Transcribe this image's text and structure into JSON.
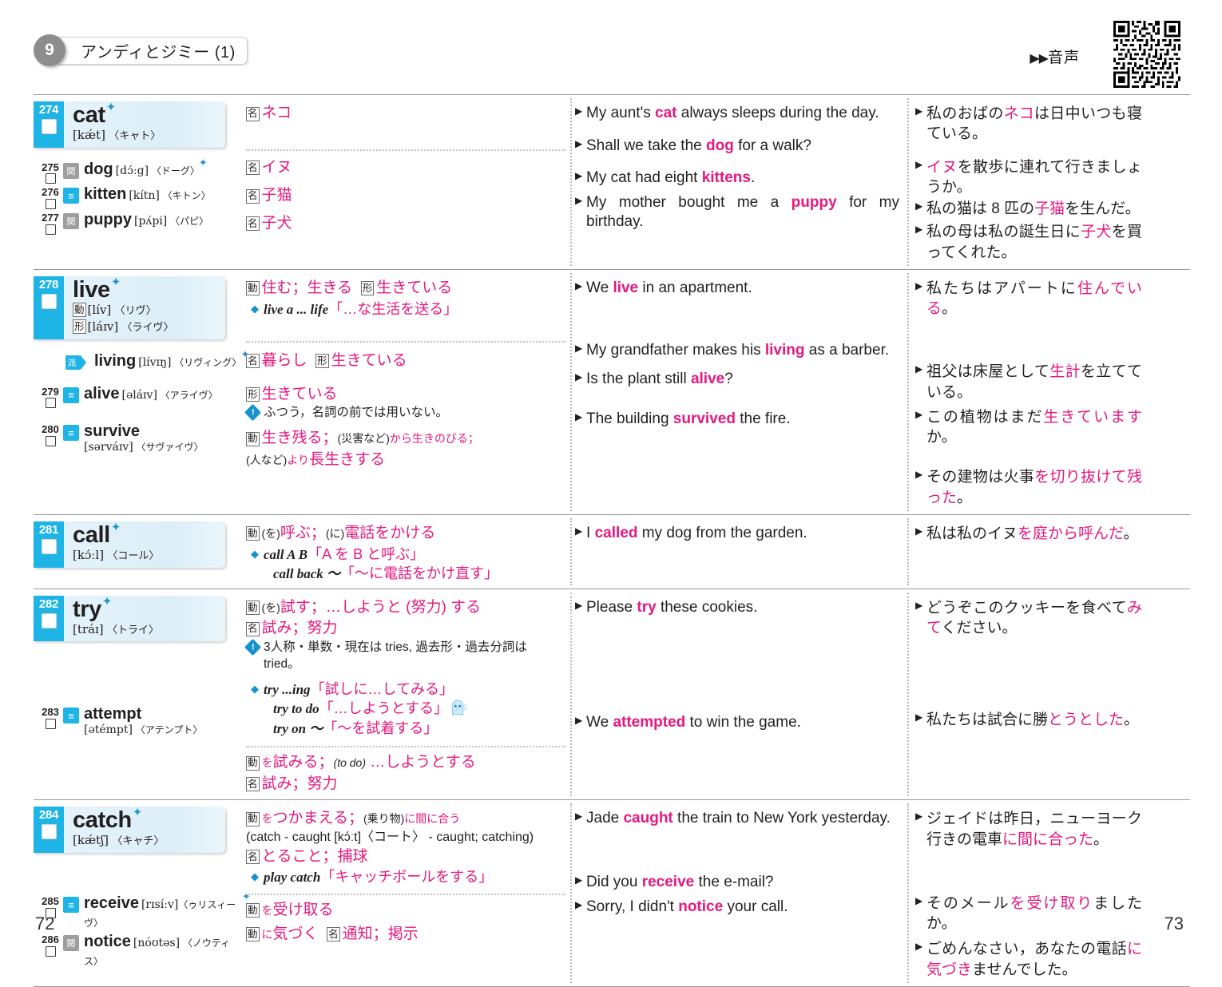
{
  "header": {
    "lesson_number": "9",
    "lesson_title": "アンディとジミー (1)",
    "audio_label": "音声",
    "audio_triangles": "▶▶",
    "qr_alt": "qr-code"
  },
  "footer": {
    "page_left": "72",
    "page_right": "73"
  },
  "blocks": [
    {
      "id": "cat",
      "headword": {
        "num": "274",
        "word": "cat",
        "star": "✦",
        "phonetic": "[kǽt]",
        "kana": "〈キャト〉"
      },
      "subs": [
        {
          "num": "275",
          "badge": "関",
          "badge_type": "kan",
          "word": "dog",
          "star": "✦",
          "phonetic": "[dɔ́ːg]",
          "kana": "〈ドーグ〉"
        },
        {
          "num": "276",
          "badge": "≡",
          "badge_type": "syn",
          "word": "kitten",
          "star": "",
          "phonetic": "[kítn]",
          "kana": "〈キトン〉"
        },
        {
          "num": "277",
          "badge": "関",
          "badge_type": "kan",
          "word": "puppy",
          "star": "",
          "phonetic": "[pʌ́pi]",
          "kana": "〈パピ〉"
        }
      ],
      "meanings": [
        {
          "pos": "名",
          "text": "ネコ"
        },
        {
          "sep": true
        },
        {
          "pos": "名",
          "text": "イヌ"
        },
        {
          "pos": "名",
          "text": "子猫"
        },
        {
          "pos": "名",
          "text": "子犬"
        }
      ],
      "examples": [
        {
          "en": "My aunt's |cat| always sleeps during the day.",
          "jp": "私のおばの|ネコ|は日中いつも寝ている。"
        },
        {
          "en": "Shall we take the |dog| for a walk?",
          "jp": "|イヌ|を散歩に連れて行きましょうか。"
        },
        {
          "en": "My cat had eight |kittens|.",
          "jp": "私の猫は 8 匹の|子猫|を生んだ。"
        },
        {
          "en": "My mother bought me a |puppy| for my birthday.",
          "jp": "私の母は私の誕生日に|子犬|を買ってくれた。"
        }
      ]
    },
    {
      "id": "live",
      "headword": {
        "num": "278",
        "word": "live",
        "star": "✦",
        "phonetic": "[lív]",
        "kana": "〈リヴ〉",
        "pos1": "動",
        "phonetic2": "[láɪv]",
        "kana2": "〈ライヴ〉",
        "pos2": "形"
      },
      "subs": [
        {
          "num": "",
          "badge": "派",
          "badge_type": "der",
          "word": "living",
          "star": "✦",
          "phonetic": "[lívɪŋ]",
          "kana": "〈リヴィング〉"
        },
        {
          "num": "279",
          "badge": "≡",
          "badge_type": "syn",
          "word": "alive",
          "star": "",
          "phonetic": "[əláɪv]",
          "kana": "〈アライヴ〉"
        },
        {
          "num": "280",
          "badge": "≡",
          "badge_type": "syn",
          "word": "survive",
          "star": "",
          "phonetic": "[sərváɪv]",
          "kana": "〈サヴァイヴ〉",
          "stacked": true
        }
      ],
      "meanings_text": {
        "live_verb": "住む；生きる",
        "live_adj": "生きている",
        "live_phrase_en": "live a ... life",
        "live_phrase_jp": "「…な生活を送る」",
        "living_noun": "暮らし",
        "living_adj": "生きている",
        "alive_adj": "生きている",
        "alive_note": "ふつう，名詞の前では用いない。",
        "survive_1": "生き残る；",
        "survive_2": "(災害など)",
        "survive_3": "から生きのびる；",
        "survive_4": "(人など)",
        "survive_5": "より",
        "survive_6": "長生きする"
      },
      "examples": [
        {
          "en": "We |live| in an apartment.",
          "jp": "私たちはアパートに|住んでいる|。"
        },
        {
          "en": "My grandfather makes his |living| as a barber.",
          "jp": "祖父は床屋として|生計|を立てている。"
        },
        {
          "en": "Is the plant still |alive|?",
          "jp": "この植物はまだ|生きています|か。"
        },
        {
          "en": "The building |survived| the fire.",
          "jp": "その建物は火事|を切り抜けて残った|。"
        }
      ]
    },
    {
      "id": "call",
      "headword": {
        "num": "281",
        "word": "call",
        "star": "✦",
        "phonetic": "[kɔ́ːl]",
        "kana": "〈コール〉"
      },
      "meanings_text": {
        "pos": "動",
        "m1a": "(を)",
        "m1b": "呼ぶ；",
        "m1c": "(に)",
        "m1d": "電話をかける",
        "p1_en": "call A B",
        "p1_jp": "「A を B と呼ぶ」",
        "p2_en": "call back ～",
        "p2_jp": "「～に電話をかけ直す」"
      },
      "examples": [
        {
          "en": "I |called| my dog from the garden.",
          "jp": "私は私のイヌ|を庭から呼んだ|。"
        }
      ]
    },
    {
      "id": "try",
      "headword": {
        "num": "282",
        "word": "try",
        "star": "✦",
        "phonetic": "[tráɪ]",
        "kana": "〈トライ〉"
      },
      "subs": [
        {
          "num": "283",
          "badge": "≡",
          "badge_type": "syn",
          "word": "attempt",
          "star": "",
          "phonetic": "[ətémpt]",
          "kana": "〈アテンプト〉",
          "stacked": true
        }
      ],
      "meanings_text": {
        "m1a": "(を)",
        "m1b": "試す；…しようと (努力) する",
        "m2": "試み；努力",
        "note": "3人称・単数・現在は tries, 過去形・過去分詞は tried。",
        "p1_en": "try ...ing",
        "p1_jp": "「試しに…してみる」",
        "p2_en": "try to do",
        "p2_jp": "「…しようとする」",
        "p3_en": "try on ～",
        "p3_jp": "「～を試着する」",
        "a1a": "を",
        "a1b": "試みる；",
        "a1c": "(to do)",
        "a1d": "…しようとする",
        "a2": "試み；努力"
      },
      "examples": [
        {
          "en": "Please |try| these cookies.",
          "jp": "どうぞこのクッキーを食べて|みて|ください。"
        },
        {
          "en": "We |attempted| to win the game.",
          "jp": "私たちは試合に勝|とうとした|。"
        }
      ]
    },
    {
      "id": "catch",
      "headword": {
        "num": "284",
        "word": "catch",
        "star": "✦",
        "phonetic": "[kǽtʃ]",
        "kana": "〈キャチ〉"
      },
      "subs": [
        {
          "num": "285",
          "badge": "≡",
          "badge_type": "syn",
          "word": "receive",
          "star": "✦",
          "phonetic": "[rɪsíːv]",
          "kana": "〈ゥリスィーヴ〉"
        },
        {
          "num": "286",
          "badge": "関",
          "badge_type": "kan",
          "word": "notice",
          "star": "",
          "phonetic": "[nóʊtəs]",
          "kana": "〈ノウティス〉"
        }
      ],
      "meanings_text": {
        "m1a": "を",
        "m1b": "つかまえる；",
        "m1c": "(乗り物)",
        "m1d": "に間に合う",
        "conj": "(catch - caught [kɔ́ːt]〈コート〉 - caught; catching)",
        "m2": "とること；捕球",
        "p1_en": "play catch",
        "p1_jp": "「キャッチボールをする」",
        "r1a": "を",
        "r1b": "受け取る",
        "n1a": "に",
        "n1b": "気づく",
        "n2": "通知；掲示"
      },
      "examples": [
        {
          "en": "Jade |caught| the train to New York yesterday.",
          "jp": "ジェイドは昨日，ニューヨーク行きの電車|に間に合った|。"
        },
        {
          "en": "Did you |receive| the e-mail?",
          "jp": "そのメール|を受け取り|ましたか。"
        },
        {
          "en": "Sorry, I didn't |notice| your call.",
          "jp": "ごめんなさい，あなたの電話|に気づき|ませんでした。"
        }
      ]
    }
  ],
  "colors": {
    "accent_cyan": "#1eb4e6",
    "accent_pink": "#e6187f",
    "badge_gray": "#9e9e9e",
    "rule": "#9a9a9a"
  }
}
